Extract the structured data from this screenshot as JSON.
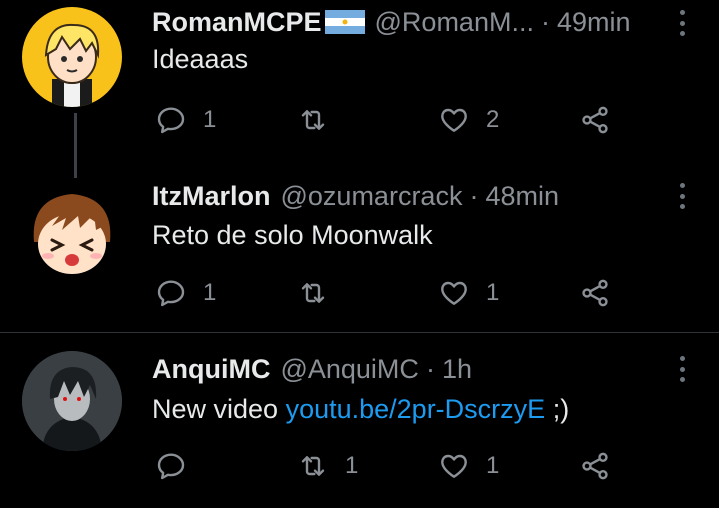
{
  "tweets": [
    {
      "name": "RomanMCPE",
      "handle": "@RomanM...",
      "time": "49min",
      "text": "Ideaaas",
      "replies": "1",
      "retweets": "",
      "likes": "2"
    },
    {
      "name": "ItzMarlon",
      "handle": "@ozumarcrack",
      "time": "48min",
      "text": "Reto de solo Moonwalk",
      "replies": "1",
      "retweets": "",
      "likes": "1"
    },
    {
      "name": "AnquiMC",
      "handle": "@AnquiMC",
      "time": "1h",
      "text": "New video ",
      "link": "youtu.be/2pr-DscrzyE",
      "text_after": " ;)",
      "replies": "",
      "retweets": "1",
      "likes": "1"
    }
  ],
  "separator": "·",
  "colors": {
    "background": "#000000",
    "link": "#1d9bf0",
    "secondary": "#8b9096"
  }
}
